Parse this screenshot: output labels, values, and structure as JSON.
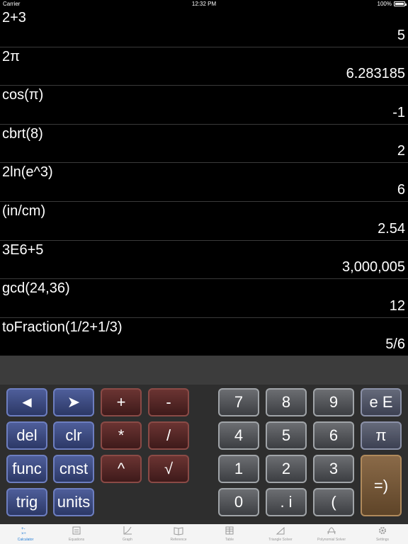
{
  "status_bar": {
    "carrier": "Carrier",
    "time": "12:32 PM",
    "battery": "100%"
  },
  "history": [
    {
      "expression": "2+3",
      "result": "5"
    },
    {
      "expression": "2π",
      "result": "6.283185"
    },
    {
      "expression": "cos(π)",
      "result": "-1"
    },
    {
      "expression": "cbrt(8)",
      "result": "2"
    },
    {
      "expression": "2ln(e^3)",
      "result": "6"
    },
    {
      "expression": "(in/cm)",
      "result": "2.54"
    },
    {
      "expression": "3E6+5",
      "result": "3,000,005"
    },
    {
      "expression": "gcd(24,36)",
      "result": "12"
    },
    {
      "expression": "toFraction(1/2+1/3)",
      "result": "5/6"
    }
  ],
  "input": {
    "value": ""
  },
  "keys": {
    "left": "◄",
    "right": "➤",
    "plus": "+",
    "minus": "-",
    "del": "del",
    "clr": "clr",
    "multiply": "*",
    "divide": "/",
    "func": "func",
    "cnst": "cnst",
    "power": "^",
    "sqrt": "√",
    "trig": "trig",
    "units": "units",
    "seven": "7",
    "eight": "8",
    "nine": "9",
    "exp": "e E",
    "four": "4",
    "five": "5",
    "six": "6",
    "pi": "π",
    "one": "1",
    "two": "2",
    "three": "3",
    "equals": "=)",
    "zero": "0",
    "dot_i": ". i",
    "paren": "("
  },
  "tabs": [
    {
      "label": "Calculator",
      "icon": "calculator-icon",
      "active": true
    },
    {
      "label": "Equations",
      "icon": "equations-icon"
    },
    {
      "label": "Graph",
      "icon": "graph-icon"
    },
    {
      "label": "Reference",
      "icon": "book-icon"
    },
    {
      "label": "Table",
      "icon": "table-icon"
    },
    {
      "label": "Triangle Solver",
      "icon": "triangle-icon"
    },
    {
      "label": "Polynomial Solver",
      "icon": "polynomial-icon"
    },
    {
      "label": "Settings",
      "icon": "gear-icon"
    }
  ],
  "colors": {
    "accent": "#1e7ad6",
    "background": "#000000"
  }
}
